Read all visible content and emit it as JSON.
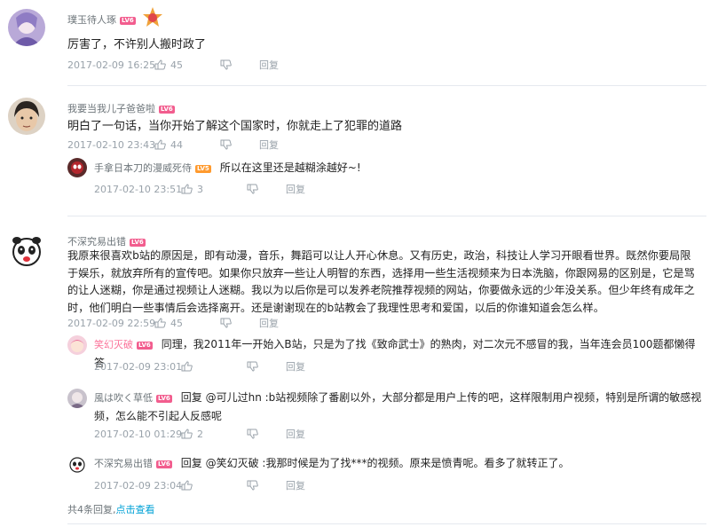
{
  "comments": [
    {
      "user": "璞玉待人琢",
      "level": "LV6",
      "text": "厉害了，不许别人搬时政了",
      "time": "2017-02-09 16:25",
      "likes": "45",
      "reply_label": "回复"
    },
    {
      "user": "我要当我儿子爸爸啦",
      "level": "LV6",
      "text": "明白了一句话，当你开始了解这个国家时，你就走上了犯罪的道路",
      "time": "2017-02-10 23:43",
      "likes": "44",
      "reply_label": "回复",
      "replies": [
        {
          "user": "手拿日本刀的漫威死侍",
          "level": "LV5",
          "text": "所以在这里还是越糊涂越好~!",
          "time": "2017-02-10 23:51",
          "likes": "3",
          "reply_label": "回复"
        }
      ]
    },
    {
      "user": "不深究易出错",
      "level": "LV6",
      "text": "我原来很喜欢b站的原因是，即有动漫，音乐，舞蹈可以让人开心休息。又有历史，政治，科技让人学习开眼看世界。既然你要局限于娱乐，就放弃所有的宣传吧。如果你只放弃一些让人明智的东西，选择用一些生活视频来为日本洗脑，你跟网易的区别是，它是骂的让人迷糊，你是通过视频让人迷糊。我以为以后你是可以发养老院推荐视频的网站，你要做永远的少年没关系。但少年终有成年之时，他们明白一些事情后会选择离开。还是谢谢现在的b站教会了我理性思考和爱国，以后的你谁知道会怎么样。",
      "time": "2017-02-09 22:59",
      "likes": "45",
      "reply_label": "回复",
      "replies": [
        {
          "user": "笑幻灭破",
          "level": "LV6",
          "text": "同理，我2011年一开始入B站，只是为了找《致命武士》的熟肉，对二次元不感冒的我，当年连会员100题都懒得答",
          "time": "2017-02-09 23:01",
          "likes": "",
          "reply_label": "回复"
        },
        {
          "user": "風は吹く草低",
          "level": "LV6",
          "text": "回复 @可儿过hn :b站视频除了番剧以外，大部分都是用户上传的吧，这样限制用户视频，特别是所谓的敏感视频，怎么能不引起人反感呢",
          "time": "2017-02-10 01:29",
          "likes": "2",
          "reply_label": "回复"
        },
        {
          "user": "不深究易出错",
          "level": "LV6",
          "text": "回复 @笑幻灭破 :我那时候是为了找***的视频。原来是愤青呢。看多了就转正了。",
          "time": "2017-02-09 23:04",
          "likes": "",
          "reply_label": "回复"
        }
      ]
    }
  ],
  "footer": {
    "count_text": "共4条回复,",
    "view_link": "点击查看"
  },
  "colors": {
    "accent_pink": "#fb7299",
    "level_badge": "#f25d8e",
    "link_blue": "#00a1d6",
    "meta_gray": "#99a2aa"
  }
}
